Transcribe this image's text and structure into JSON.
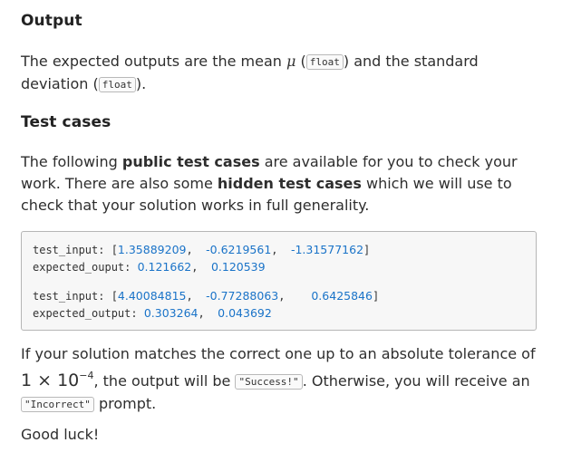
{
  "output_section": {
    "heading": "Output",
    "text_1": "The expected outputs are the mean ",
    "mu_symbol": "μ",
    "text_2": " (",
    "type_1": "float",
    "text_3": ") and the standard deviation (",
    "type_2": "float",
    "text_4": ")."
  },
  "test_section": {
    "heading": "Test cases",
    "text_1": "The following ",
    "bold_1": "public test cases",
    "text_2": " are available for you to check your work. There are also some ",
    "bold_2": "hidden test cases",
    "text_3": " which we will use to check that your solution works in full generality."
  },
  "code": {
    "case1_input_label": "test_input: [",
    "case1_input_values": [
      "1.35889209",
      "-0.6219561",
      "-1.31577162"
    ],
    "case1_output_label": "expected_ouput: ",
    "case1_output_values": [
      "0.121662",
      "0.120539"
    ],
    "case2_input_label": "test_input: [",
    "case2_input_values": [
      "4.40084815",
      "-0.77288063",
      "0.6425846"
    ],
    "case2_output_label": "expected_output: ",
    "case2_output_values": [
      "0.303264",
      "0.043692"
    ]
  },
  "tolerance": {
    "text_1": "If your solution matches the correct one up to an absolute tolerance of ",
    "tol_base": "1 × 10",
    "tol_exp": "−4",
    "text_2": ", the output will be ",
    "success_literal": "\"Success!\"",
    "text_3": ". Otherwise, you will receive an ",
    "incorrect_literal": "\"Incorrect\"",
    "text_4": " prompt."
  },
  "closing": "Good luck!"
}
